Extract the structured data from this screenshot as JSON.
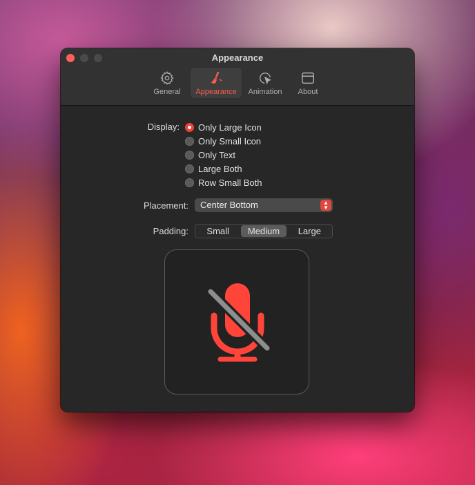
{
  "window": {
    "title": "Appearance"
  },
  "toolbar": {
    "items": [
      {
        "label": "General",
        "icon": "gear-icon",
        "active": false
      },
      {
        "label": "Appearance",
        "icon": "paintbrush-icon",
        "active": true
      },
      {
        "label": "Animation",
        "icon": "cursor-click-icon",
        "active": false
      },
      {
        "label": "About",
        "icon": "window-icon",
        "active": false
      }
    ]
  },
  "display": {
    "label": "Display:",
    "options": [
      "Only Large Icon",
      "Only Small Icon",
      "Only Text",
      "Large Both",
      "Row Small Both"
    ],
    "selected": "Only Large Icon"
  },
  "placement": {
    "label": "Placement:",
    "value": "Center Bottom"
  },
  "padding": {
    "label": "Padding:",
    "options": [
      "Small",
      "Medium",
      "Large"
    ],
    "selected": "Medium"
  },
  "preview": {
    "icon": "microphone-muted-icon"
  },
  "colors": {
    "accent": "#ef4136",
    "mic": "#ff453a",
    "slash": "#8e8e8e"
  }
}
